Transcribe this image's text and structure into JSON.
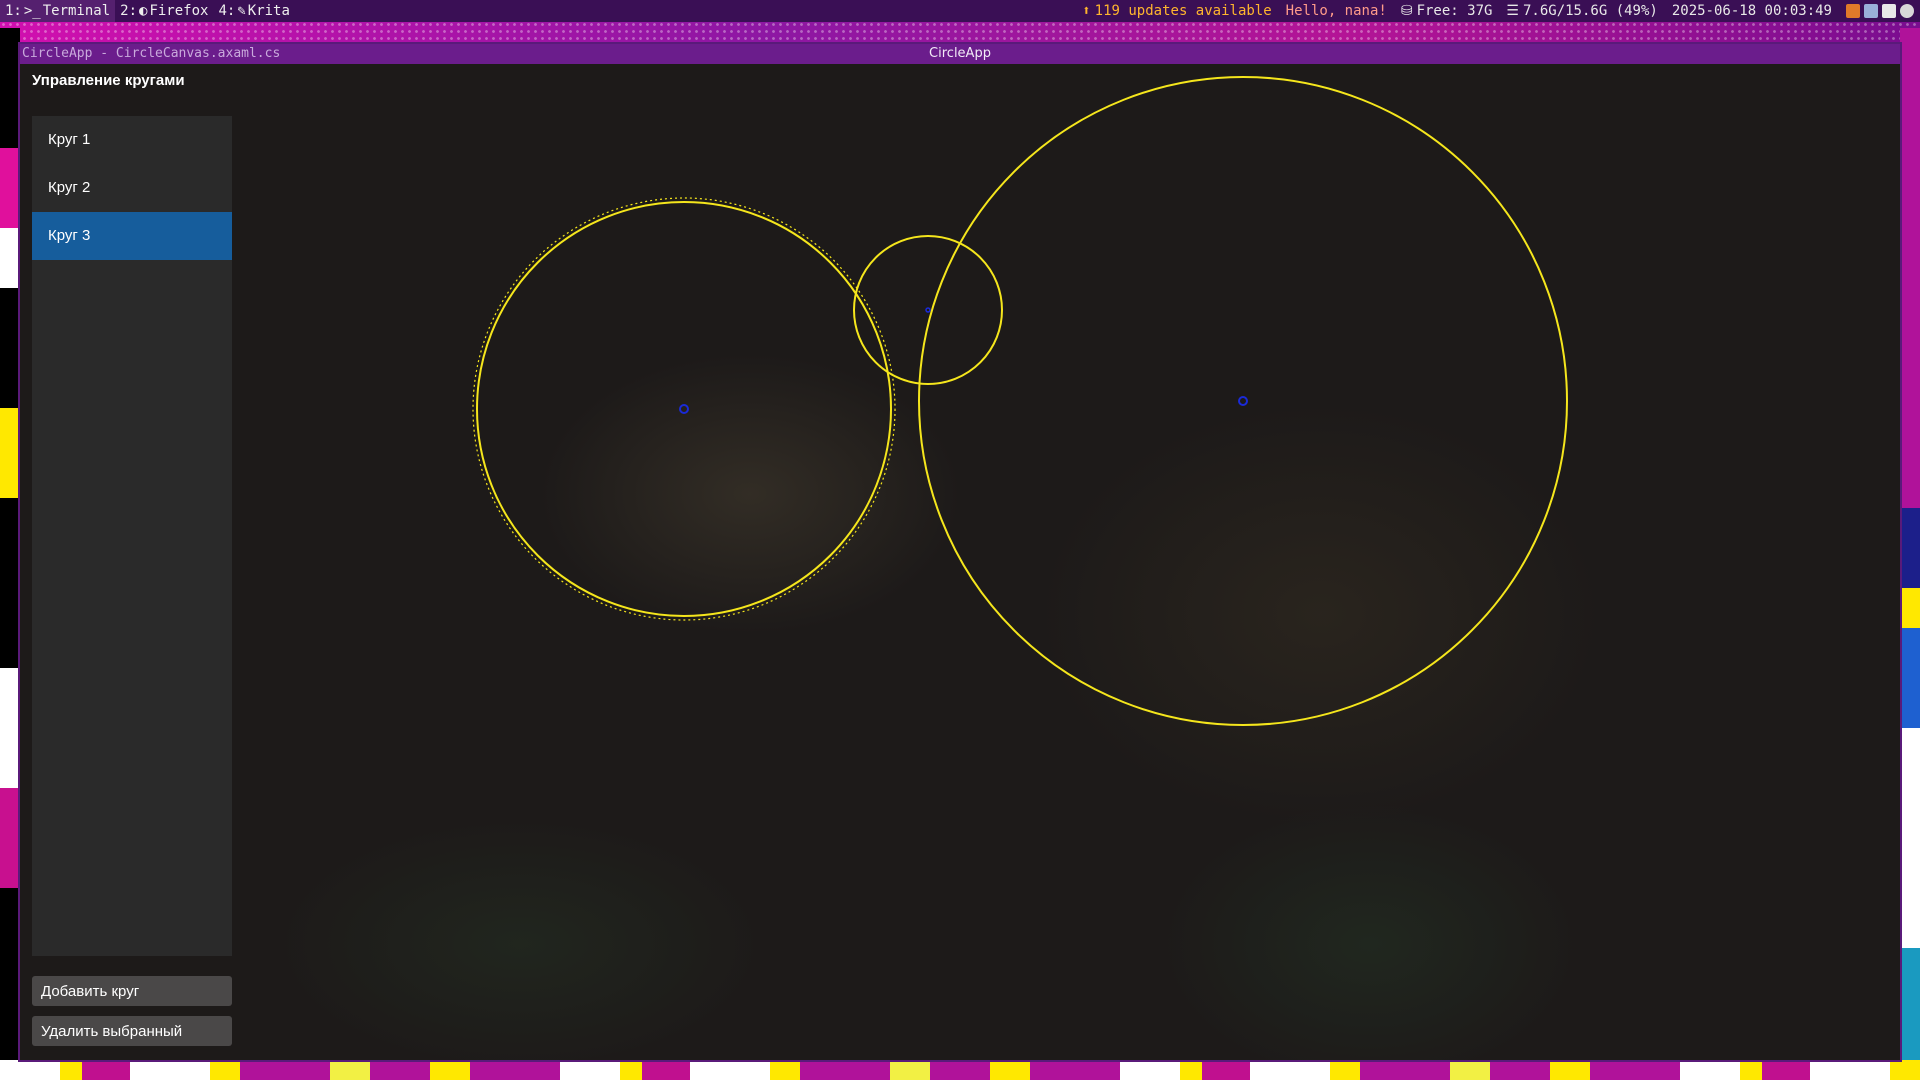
{
  "topbar": {
    "workspaces": [
      {
        "num": "1:",
        "icon": ">_",
        "label": "Terminal"
      },
      {
        "num": "2:",
        "icon": "◐",
        "label": "Firefox"
      },
      {
        "num": "4:",
        "icon": "✎",
        "label": "Krita"
      }
    ],
    "updates": "119 updates available",
    "greeting": "Hello, nana!",
    "disk": "Free: 37G",
    "memory": "7.6G/15.6G (49%)",
    "datetime": "2025-06-18 00:03:49"
  },
  "window": {
    "left_title": "CircleApp - CircleCanvas.axaml.cs",
    "center_title": "CircleApp"
  },
  "panel": {
    "title": "Управление кругами",
    "items": [
      {
        "label": "Круг 1",
        "selected": false
      },
      {
        "label": "Круг 2",
        "selected": false
      },
      {
        "label": "Круг 3",
        "selected": true
      }
    ],
    "add_button": "Добавить круг",
    "delete_button": "Удалить выбранный"
  },
  "colors": {
    "circle_stroke": "#f5e61c",
    "center_dot": "#1a2ad8",
    "selection": "#165d9c",
    "titlebar": "#6b1d8c"
  }
}
